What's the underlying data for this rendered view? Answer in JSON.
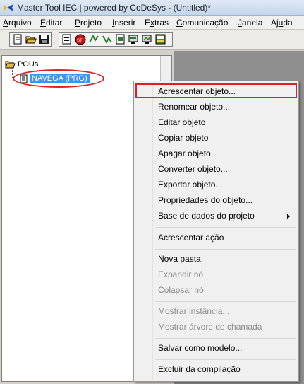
{
  "window": {
    "title": "Master Tool IEC | powered by CoDeSys - (Untitled)*"
  },
  "menubar": [
    {
      "label": "Arquivo",
      "key": "A"
    },
    {
      "label": "Editar",
      "key": "E"
    },
    {
      "label": "Projeto",
      "key": "P"
    },
    {
      "label": "Inserir",
      "key": "I"
    },
    {
      "label": "Extras",
      "key": "x"
    },
    {
      "label": "Comunicação",
      "key": "C"
    },
    {
      "label": "Janela",
      "key": "J"
    },
    {
      "label": "Ajuda",
      "key": "u"
    }
  ],
  "toolbar": {
    "icons": [
      "new-icon",
      "open-icon",
      "save-icon",
      "build-icon",
      "stop-icon",
      "login-icon",
      "logout-icon",
      "download-icon",
      "upload-icon",
      "online-icon"
    ]
  },
  "tree": {
    "root_label": "POUs",
    "selected_item": "NAVEGA (PRG)"
  },
  "context_menu": {
    "items": [
      {
        "label": "Acrescentar objeto...",
        "enabled": true
      },
      {
        "label": "Renomear objeto...",
        "enabled": true
      },
      {
        "label": "Editar objeto",
        "enabled": true
      },
      {
        "label": "Copiar objeto",
        "enabled": true
      },
      {
        "label": "Apagar objeto",
        "enabled": true
      },
      {
        "label": "Converter objeto...",
        "enabled": true
      },
      {
        "label": "Exportar objeto...",
        "enabled": true
      },
      {
        "label": "Propriedades do objeto...",
        "enabled": true
      },
      {
        "label": "Base de dados do projeto",
        "enabled": true
      },
      {
        "label": "Acrescentar ação",
        "enabled": true
      },
      {
        "label": "Nova pasta",
        "enabled": true
      },
      {
        "label": "Expandir nó",
        "enabled": false
      },
      {
        "label": "Colapsar nó",
        "enabled": false
      },
      {
        "label": "Mostrar instância...",
        "enabled": false
      },
      {
        "label": "Mostrar árvore de chamada",
        "enabled": false
      },
      {
        "label": "Salvar como modelo...",
        "enabled": true
      },
      {
        "label": "Excluir da compilação",
        "enabled": true
      }
    ]
  },
  "colors": {
    "selection": "#3399ff",
    "annotation": "#e02020"
  }
}
